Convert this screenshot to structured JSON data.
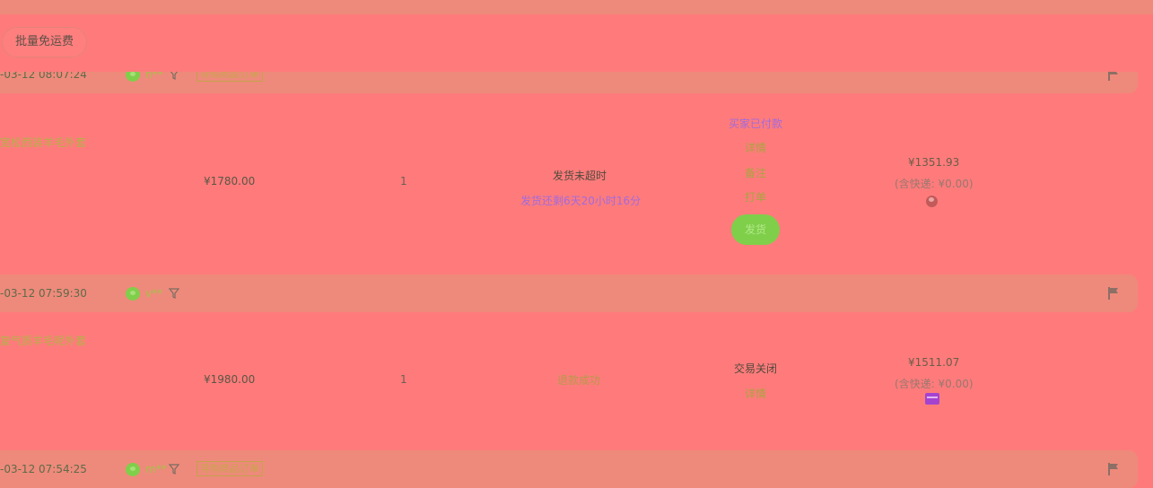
{
  "toolbar": {
    "batch_free_shipping_label": "批量免运费"
  },
  "orders": [
    {
      "time": "-03-12 08:07:24",
      "buyer": "h**",
      "tag": "导购商品订单",
      "title": "宽松西装羊毛外套",
      "price": "¥1780.00",
      "qty": "1",
      "ship_status": "发货未超时",
      "ship_countdown": "发货还剩6天20小时16分",
      "trade_status": "买家已付款",
      "links": [
        "详情",
        "备注",
        "打单"
      ],
      "ship_button": "发货",
      "total": "¥1351.93",
      "shipping_fee": "(含快递: ¥0.00)",
      "payment_icon": "wallet-icon"
    },
    {
      "time": "-03-12 07:59:30",
      "buyer": "v**",
      "title": "复气质羊毛呢外套",
      "price": "¥1980.00",
      "qty": "1",
      "refund_status": "退款成功",
      "trade_status": "交易关闭",
      "links": [
        "详情"
      ],
      "total": "¥1511.07",
      "shipping_fee": "(含快递: ¥0.00)",
      "payment_icon": "card-icon"
    },
    {
      "time": "-03-12 07:54:25",
      "buyer": "m**",
      "tag": "导购商品订单"
    }
  ],
  "colors": {
    "background": "#ff7b7b",
    "header": "#ee8a7b",
    "accent_green": "#7fcf4a",
    "accent_purple": "#a16adf"
  }
}
